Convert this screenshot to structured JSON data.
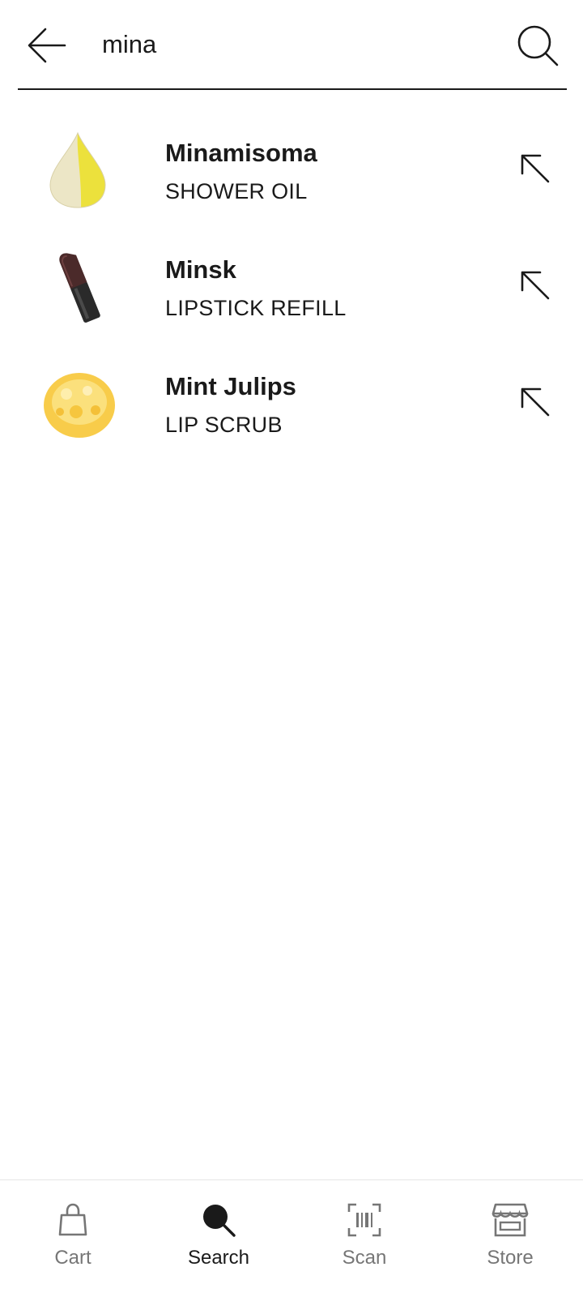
{
  "search": {
    "query": "mina",
    "back_icon": "arrow-left-icon",
    "submit_icon": "search-icon"
  },
  "results": [
    {
      "title": "Minamisoma",
      "subtitle": "SHOWER OIL",
      "image": "shower-oil-drop-image",
      "action_icon": "arrow-up-left-icon"
    },
    {
      "title": "Minsk",
      "subtitle": "LIPSTICK REFILL",
      "image": "lipstick-refill-image",
      "action_icon": "arrow-up-left-icon"
    },
    {
      "title": "Mint Julips",
      "subtitle": "LIP SCRUB",
      "image": "lip-scrub-image",
      "action_icon": "arrow-up-left-icon"
    }
  ],
  "nav": {
    "active": "Search",
    "items": [
      {
        "label": "Cart",
        "icon": "shopping-bag-icon"
      },
      {
        "label": "Search",
        "icon": "search-icon"
      },
      {
        "label": "Scan",
        "icon": "barcode-scan-icon"
      },
      {
        "label": "Store",
        "icon": "storefront-icon"
      }
    ]
  },
  "colors": {
    "text": "#1a1a1a",
    "inactive_nav": "#767676",
    "divider": "#1a1a1a"
  }
}
